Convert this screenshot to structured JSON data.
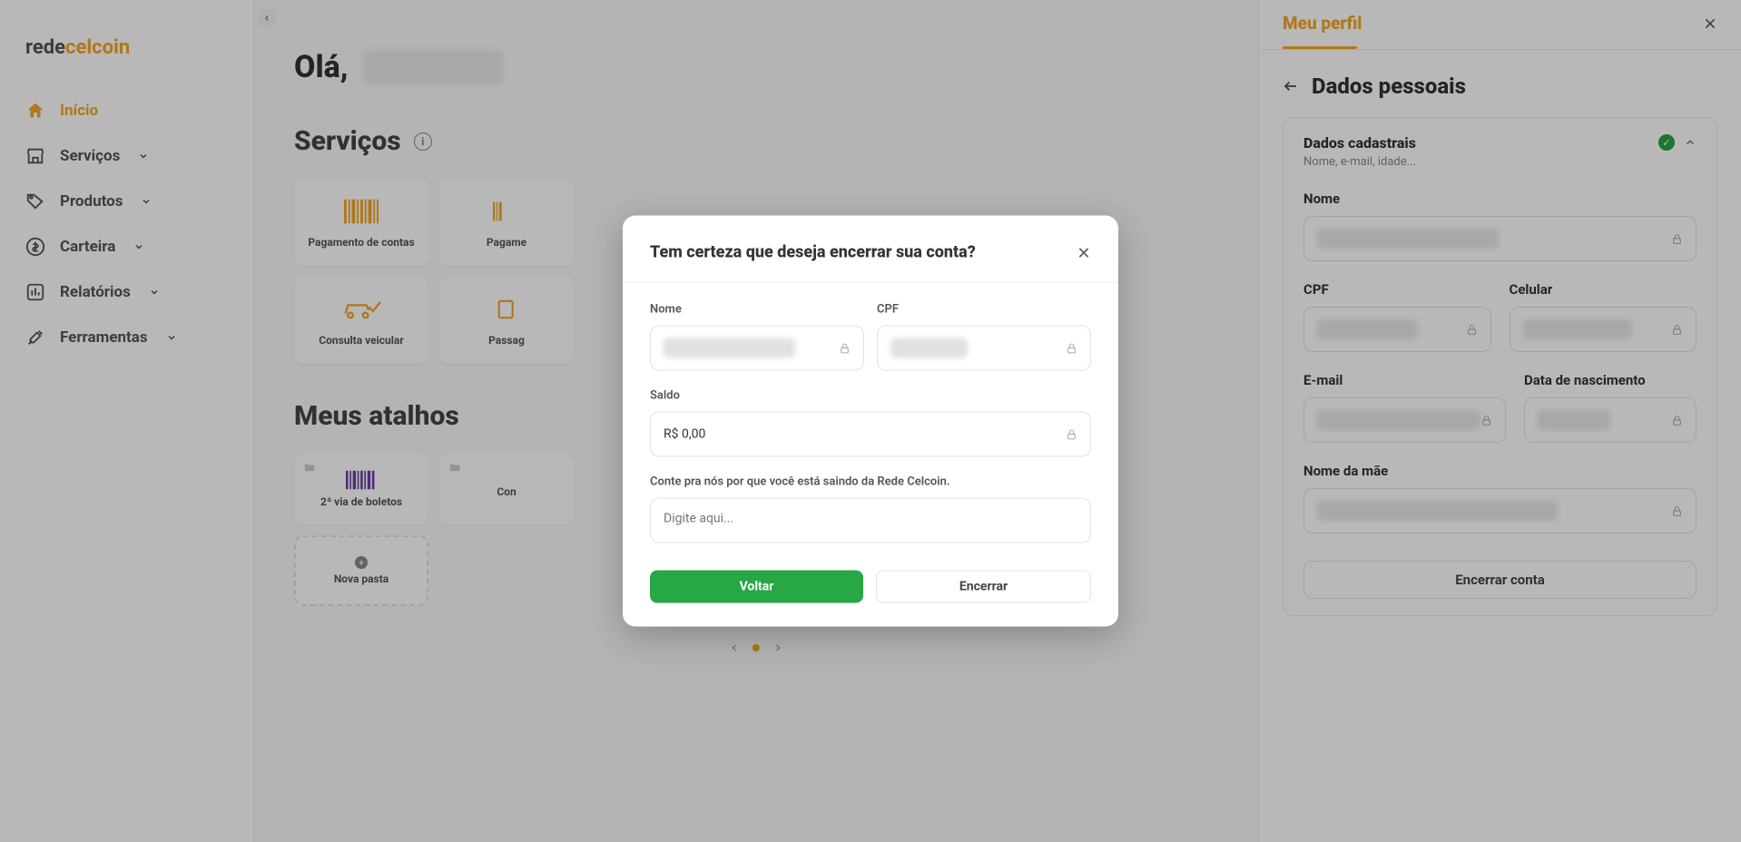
{
  "brand": {
    "part1": "rede",
    "part2": "celcoin"
  },
  "nav": {
    "home": "Início",
    "services": "Serviços",
    "products": "Produtos",
    "wallet": "Carteira",
    "reports": "Relatórios",
    "tools": "Ferramentas"
  },
  "main": {
    "greeting_prefix": "Olá,",
    "services_title": "Serviços",
    "svc": {
      "pay_bills": "Pagamento de contas",
      "pay_partial": "Pagame",
      "vehicle": "Consulta veicular",
      "pass": "Passag"
    },
    "shortcuts_title": "Meus atalhos",
    "shortcut": {
      "boletos": "2ª via de boletos",
      "con": "Con"
    },
    "new_folder": "Nova pasta"
  },
  "panel": {
    "title": "Meu perfil",
    "subtitle": "Dados pessoais",
    "card_title": "Dados cadastrais",
    "card_sub": "Nome, e-mail, idade...",
    "labels": {
      "name": "Nome",
      "cpf": "CPF",
      "cel": "Celular",
      "email": "E-mail",
      "dob": "Data de nascimento",
      "mother": "Nome da mãe"
    },
    "close_account": "Encerrar conta"
  },
  "modal": {
    "title": "Tem certeza que deseja encerrar sua conta?",
    "labels": {
      "name": "Nome",
      "cpf": "CPF",
      "balance": "Saldo"
    },
    "balance_value": "R$ 0,00",
    "reason_label": "Conte pra nós por que você está saindo da Rede Celcoin.",
    "reason_placeholder": "Digite aqui...",
    "back": "Voltar",
    "confirm": "Encerrar"
  }
}
